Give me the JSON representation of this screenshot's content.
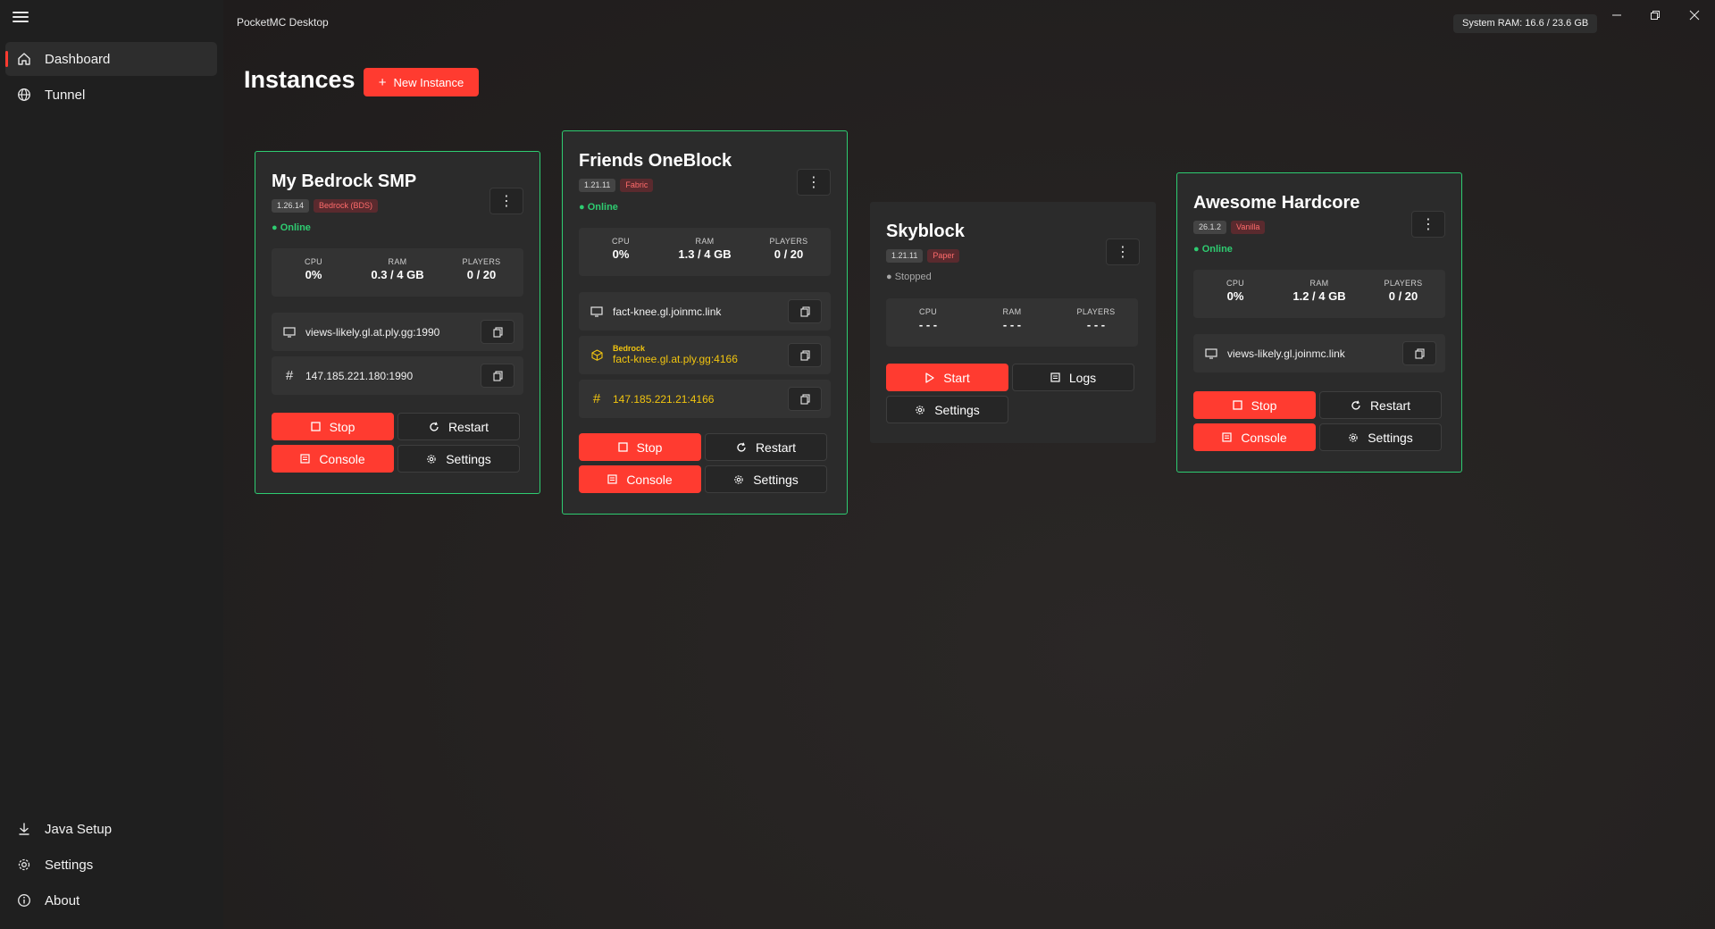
{
  "app": {
    "title": "PocketMC Desktop",
    "system_ram": "System RAM: 16.6 / 23.6 GB"
  },
  "sidebar": {
    "top_items": [
      {
        "label": "Dashboard",
        "icon": "home-icon",
        "active": true
      },
      {
        "label": "Tunnel",
        "icon": "globe-icon",
        "active": false
      }
    ],
    "bottom_items": [
      {
        "label": "Java Setup",
        "icon": "download-icon"
      },
      {
        "label": "Settings",
        "icon": "gear-icon"
      },
      {
        "label": "About",
        "icon": "info-icon"
      }
    ]
  },
  "main": {
    "title": "Instances",
    "new_instance_label": "New Instance"
  },
  "labels": {
    "cpu": "CPU",
    "ram": "RAM",
    "players": "PLAYERS",
    "stop": "Stop",
    "restart": "Restart",
    "console": "Console",
    "settings": "Settings",
    "start": "Start",
    "logs": "Logs"
  },
  "instances": [
    {
      "name": "My Bedrock SMP",
      "version": "1.26.14",
      "type": "Bedrock (BDS)",
      "status": "Online",
      "cpu": "0%",
      "ram": "0.3 / 4 GB",
      "players": "0 / 20",
      "address": "views-likely.gl.at.ply.gg:1990",
      "ip": "147.185.221.180:1990"
    },
    {
      "name": "Friends OneBlock",
      "version": "1.21.11",
      "type": "Fabric",
      "status": "Online",
      "cpu": "0%",
      "ram": "1.3 / 4 GB",
      "players": "0 / 20",
      "address": "fact-knee.gl.joinmc.link",
      "bedrock_label": "Bedrock",
      "bedrock_address": "fact-knee.gl.at.ply.gg:4166",
      "ip": "147.185.221.21:4166"
    },
    {
      "name": "Skyblock",
      "version": "1.21.11",
      "type": "Paper",
      "status": "Stopped",
      "cpu": "- - -",
      "ram": "- - -",
      "players": "- - -"
    },
    {
      "name": "Awesome Hardcore",
      "version": "26.1.2",
      "type": "Vanilla",
      "status": "Online",
      "cpu": "0%",
      "ram": "1.2 / 4 GB",
      "players": "0 / 20",
      "address": "views-likely.gl.joinmc.link"
    }
  ],
  "colors": {
    "accent": "#ff3b30",
    "online": "#2ecc71",
    "bedrock": "#f1c40f"
  }
}
